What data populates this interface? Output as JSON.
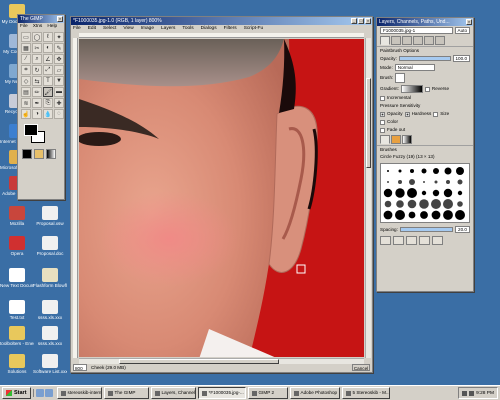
{
  "colors": {
    "desktop": "#3a6ea5",
    "title_active": "#0a246a",
    "window_face": "#d4d0c8",
    "photo_background": "#c61414"
  },
  "desktop_icons": [
    {
      "label": "My Documents",
      "icon": "folder-icon",
      "color": "#e8c85c"
    },
    {
      "label": "My Computer",
      "icon": "computer-icon",
      "color": "#9fb8d8"
    },
    {
      "label": "My Network",
      "icon": "network-icon",
      "color": "#7fa8d0"
    },
    {
      "label": "Recycle Bin",
      "icon": "trash-icon",
      "color": "#c8ccd8"
    },
    {
      "label": "Internet Explorer",
      "icon": "browser-icon",
      "color": "#3c7fd0"
    },
    {
      "label": "Microsoft Outlook",
      "icon": "mail-icon",
      "color": "#e0b04c"
    },
    {
      "label": "Adobe Reader",
      "icon": "pdf-icon",
      "color": "#c83a3a"
    },
    {
      "label": "Mozilla",
      "icon": "mozilla-icon",
      "color": "#c8463c"
    },
    {
      "label": "Proposal.xsw",
      "icon": "document-icon",
      "color": "#f0f0f0"
    },
    {
      "label": "Opera",
      "icon": "opera-icon",
      "color": "#d03030"
    },
    {
      "label": "Proposal.doc",
      "icon": "document-icon",
      "color": "#f0f0f0"
    },
    {
      "label": "New Text Document.txt",
      "icon": "text-file-icon",
      "color": "#ffffff"
    },
    {
      "label": "Flashform Blowfly",
      "icon": "app-icon",
      "color": "#e8e0c0"
    },
    {
      "label": "Test.txt",
      "icon": "text-file-icon",
      "color": "#ffffff"
    },
    {
      "label": "ssss.xls.xxx",
      "icon": "spreadsheet-icon",
      "color": "#f0f0f0"
    },
    {
      "label": "toolbolters - Energy Tw...",
      "icon": "folder-icon",
      "color": "#e8c85c"
    },
    {
      "label": "ssss.xls.xxx",
      "icon": "spreadsheet-icon",
      "color": "#f0f0f0"
    },
    {
      "label": "Solutions",
      "icon": "folder-icon",
      "color": "#e8c85c"
    },
    {
      "label": "Software List.xxxx",
      "icon": "document-icon",
      "color": "#f0f0f0"
    }
  ],
  "toolbox": {
    "title": "The GIMP",
    "menu": [
      "File",
      "Xtns",
      "Help"
    ]
  },
  "image_window": {
    "title": "*F1000035.jpg-1.0 (RGB, 1 layer) 800%",
    "menu": [
      "File",
      "Edit",
      "Select",
      "View",
      "Image",
      "Layers",
      "Tools",
      "Dialogs",
      "Filters",
      "Script-Fu"
    ],
    "zoom": "800",
    "status": "Cheek (29.0 MB)",
    "cancel": "Cancel"
  },
  "layers_dialog": {
    "title": "Layers, Channels, Paths, Und...",
    "image_select": "F1000035.jpg-1",
    "auto_label": "Auto",
    "tool_options_title": "Paintbrush Options",
    "opacity_label": "Opacity:",
    "opacity_value": "100.0",
    "mode_label": "Mode:",
    "mode_value": "Normal",
    "brush_label": "Brush:",
    "gradient_label": "Gradient:",
    "reverse_label": "Reverse",
    "incremental_label": "Incremental",
    "pressure_label": "Pressure Sensitivity",
    "opacity_check": "Opacity",
    "hardness_check": "Hardness",
    "size_check": "Size",
    "color_check": "Color",
    "fade_label": "Fade out",
    "brushes_title": "Brushes",
    "brush_name": "Circle Fuzzy (19) (13 × 13)",
    "spacing_label": "Spacing:",
    "spacing_value": "20.0"
  },
  "zoom_readout": "Auto",
  "taskbar": {
    "start": "Start",
    "tasks": [
      {
        "label": "stereoskib-internet",
        "active": false
      },
      {
        "label": "The GIMP",
        "active": false
      },
      {
        "label": "Layers, Channel...",
        "active": false
      },
      {
        "label": "*F1000035.jpg-...",
        "active": true
      },
      {
        "label": "GIMP 2",
        "active": false
      },
      {
        "label": "Adobe Photoshop",
        "active": false
      },
      {
        "label": "5 Stereoskib - M...",
        "active": false
      }
    ],
    "clock": "9:28 PM"
  }
}
